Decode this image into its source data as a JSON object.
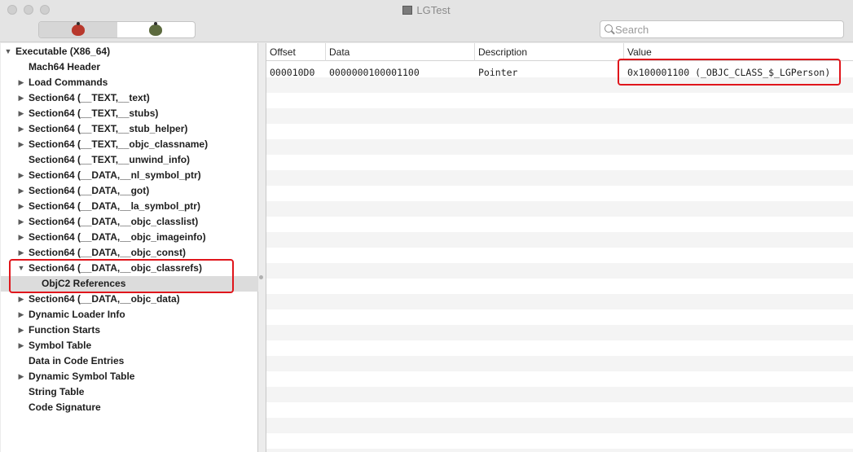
{
  "window": {
    "title": "LGTest"
  },
  "toolbar": {
    "segments": [
      {
        "icon": "red-bug-icon",
        "color": "#b8382c",
        "active": true
      },
      {
        "icon": "green-bug-icon",
        "color": "#5c6a3e",
        "active": false
      }
    ],
    "search_placeholder": "Search"
  },
  "tree": {
    "items": [
      {
        "label": "Executable  (X86_64)",
        "expander": "open",
        "level": 0
      },
      {
        "label": "Mach64 Header",
        "expander": "none",
        "level": 1
      },
      {
        "label": "Load Commands",
        "expander": "closed",
        "level": 1
      },
      {
        "label": "Section64 (__TEXT,__text)",
        "expander": "closed",
        "level": 1
      },
      {
        "label": "Section64 (__TEXT,__stubs)",
        "expander": "closed",
        "level": 1
      },
      {
        "label": "Section64 (__TEXT,__stub_helper)",
        "expander": "closed",
        "level": 1
      },
      {
        "label": "Section64 (__TEXT,__objc_classname)",
        "expander": "closed",
        "level": 1
      },
      {
        "label": "Section64 (__TEXT,__unwind_info)",
        "expander": "none",
        "level": 1
      },
      {
        "label": "Section64 (__DATA,__nl_symbol_ptr)",
        "expander": "closed",
        "level": 1
      },
      {
        "label": "Section64 (__DATA,__got)",
        "expander": "closed",
        "level": 1
      },
      {
        "label": "Section64 (__DATA,__la_symbol_ptr)",
        "expander": "closed",
        "level": 1
      },
      {
        "label": "Section64 (__DATA,__objc_classlist)",
        "expander": "closed",
        "level": 1
      },
      {
        "label": "Section64 (__DATA,__objc_imageinfo)",
        "expander": "closed",
        "level": 1
      },
      {
        "label": "Section64 (__DATA,__objc_const)",
        "expander": "closed",
        "level": 1
      },
      {
        "label": "Section64 (__DATA,__objc_classrefs)",
        "expander": "open",
        "level": 1
      },
      {
        "label": "ObjC2 References",
        "expander": "none",
        "level": 2,
        "selected": true
      },
      {
        "label": "Section64 (__DATA,__objc_data)",
        "expander": "closed",
        "level": 1
      },
      {
        "label": "Dynamic Loader Info",
        "expander": "closed",
        "level": 1
      },
      {
        "label": "Function Starts",
        "expander": "closed",
        "level": 1
      },
      {
        "label": "Symbol Table",
        "expander": "closed",
        "level": 1
      },
      {
        "label": "Data in Code Entries",
        "expander": "none",
        "level": 1
      },
      {
        "label": "Dynamic Symbol Table",
        "expander": "closed",
        "level": 1
      },
      {
        "label": "String Table",
        "expander": "none",
        "level": 1
      },
      {
        "label": "Code Signature",
        "expander": "none",
        "level": 1
      }
    ]
  },
  "table": {
    "columns": [
      "Offset",
      "Data",
      "Description",
      "Value"
    ],
    "rows": [
      [
        "000010D0",
        "0000000100001100",
        "Pointer",
        "0x100001100 (_OBJC_CLASS_$_LGPerson)"
      ]
    ]
  },
  "annotations": {
    "highlight_color": "#e0161c"
  }
}
